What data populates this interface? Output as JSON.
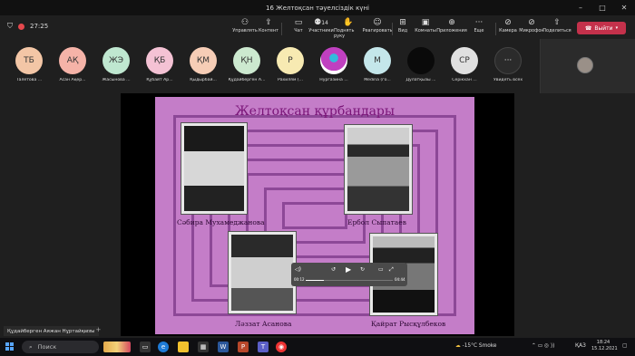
{
  "window": {
    "title": "16 Желтоқсан тәуелсіздік күні"
  },
  "meeting": {
    "timer": "27:25",
    "participants_count": "14"
  },
  "toolbar": {
    "items": [
      {
        "label": "Управлять",
        "icon": "person-shield-icon"
      },
      {
        "label": "Контент",
        "icon": "share-icon"
      },
      {
        "label": "Чат",
        "icon": "chat-icon"
      },
      {
        "label": "Участники",
        "icon": "people-icon"
      },
      {
        "label": "Поднять руку",
        "icon": "hand-icon"
      },
      {
        "label": "Реагировать",
        "icon": "smile-icon"
      },
      {
        "label": "Вид",
        "icon": "grid-icon"
      },
      {
        "label": "Комнаты",
        "icon": "rooms-icon"
      },
      {
        "label": "Приложения",
        "icon": "plus-icon"
      },
      {
        "label": "Еще",
        "icon": "more-icon"
      },
      {
        "label": "Камера",
        "icon": "camera-off-icon"
      },
      {
        "label": "Микрофон",
        "icon": "mic-off-icon"
      },
      {
        "label": "Поделиться",
        "icon": "share-screen-icon"
      }
    ],
    "leave_label": "Выйти"
  },
  "participants": [
    {
      "initials": "ТБ",
      "name": "Талетова ...",
      "color": "#f3c6a6"
    },
    {
      "initials": "АҚ",
      "name": "Асан Ақер...",
      "color": "#f5b3a8"
    },
    {
      "initials": "ЖЭ",
      "name": "Жасынова ...",
      "color": "#bfe7d0"
    },
    {
      "initials": "ҚБ",
      "name": "Құбайт Ар...",
      "color": "#f4c2d4"
    },
    {
      "initials": "ҚМ",
      "name": "Қыдырбай...",
      "color": "#f6cdb6"
    },
    {
      "initials": "ҚН",
      "name": "Құдайберген А...",
      "color": "#cce9cf"
    },
    {
      "initials": "Р",
      "name": "Рахилям (...",
      "color": "#f7eab2"
    },
    {
      "initials": "",
      "name": "Нургазина ...",
      "color": "#c040c0"
    },
    {
      "initials": "M",
      "name": "Medina (го...",
      "color": "#c4e6ea"
    },
    {
      "initials": "",
      "name": "Дулатқызы ...",
      "color": "#111111"
    },
    {
      "initials": "СР",
      "name": "Серікхан ...",
      "color": "#e0e0e0"
    },
    {
      "initials": "···",
      "name": "Увидеть всех",
      "color": "#2b2b2b"
    }
  ],
  "slide": {
    "title": "Желтоқсан құрбандары",
    "captions": [
      "Сәбира Мухамеджанова",
      "Ербол Сыпатаев",
      "Ләззат Асанова",
      "Қайрат Рысқұлбеков"
    ]
  },
  "player": {
    "time_current": "00:12",
    "time_total": "04:44"
  },
  "presenter": {
    "name": "Құдайберген Аяжан Нұртайқызы"
  },
  "taskbar": {
    "search_label": "Поиск",
    "weather": "-15°C  Smoke",
    "language": "ҚАЗ",
    "time": "18:24",
    "date": "15.12.2021"
  }
}
